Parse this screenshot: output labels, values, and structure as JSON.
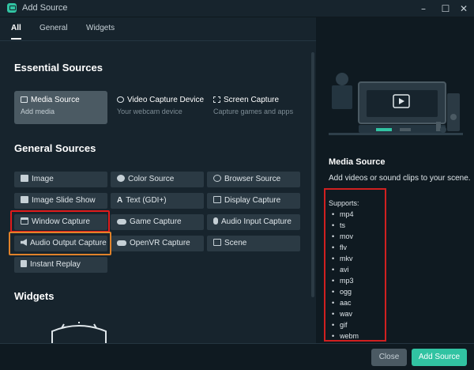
{
  "window": {
    "title": "Add Source",
    "minimize_icon": "minimize-icon",
    "maximize_icon": "maximize-icon",
    "close_icon": "close-icon"
  },
  "tabs": [
    {
      "label": "All",
      "active": true
    },
    {
      "label": "General",
      "active": false
    },
    {
      "label": "Widgets",
      "active": false
    }
  ],
  "essential": {
    "title": "Essential Sources",
    "cards": [
      {
        "title": "Media Source",
        "subtitle": "Add media",
        "icon": "media-icon",
        "selected": true
      },
      {
        "title": "Video Capture Device",
        "subtitle": "Your webcam device",
        "icon": "webcam-icon",
        "selected": false
      },
      {
        "title": "Screen Capture",
        "subtitle": "Capture games and apps",
        "icon": "screen-capture-icon",
        "selected": false
      }
    ]
  },
  "general": {
    "title": "General Sources",
    "items": [
      {
        "label": "Image",
        "icon": "image-icon"
      },
      {
        "label": "Color Source",
        "icon": "color-icon"
      },
      {
        "label": "Browser Source",
        "icon": "globe-icon"
      },
      {
        "label": "Image Slide Show",
        "icon": "slideshow-icon"
      },
      {
        "label": "Text (GDI+)",
        "icon": "text-icon"
      },
      {
        "label": "Display Capture",
        "icon": "monitor-icon"
      },
      {
        "label": "Window Capture",
        "icon": "window-icon"
      },
      {
        "label": "Game Capture",
        "icon": "gamepad-icon"
      },
      {
        "label": "Audio Input Capture",
        "icon": "microphone-icon"
      },
      {
        "label": "Audio Output Capture",
        "icon": "speaker-icon"
      },
      {
        "label": "OpenVR Capture",
        "icon": "vr-icon"
      },
      {
        "label": "Scene",
        "icon": "scene-icon"
      },
      {
        "label": "Instant Replay",
        "icon": "replay-icon"
      }
    ]
  },
  "widgets": {
    "title": "Widgets"
  },
  "details": {
    "title": "Media Source",
    "description": "Add videos or sound clips to your scene.",
    "supports_label": "Supports:",
    "formats": [
      "mp4",
      "ts",
      "mov",
      "flv",
      "mkv",
      "avi",
      "mp3",
      "ogg",
      "aac",
      "wav",
      "gif",
      "webm"
    ]
  },
  "footer": {
    "close_label": "Close",
    "add_label": "Add Source"
  },
  "colors": {
    "accent": "#31c3a2",
    "highlight_red": "#e01b1b",
    "highlight_orange": "#e0822a"
  }
}
